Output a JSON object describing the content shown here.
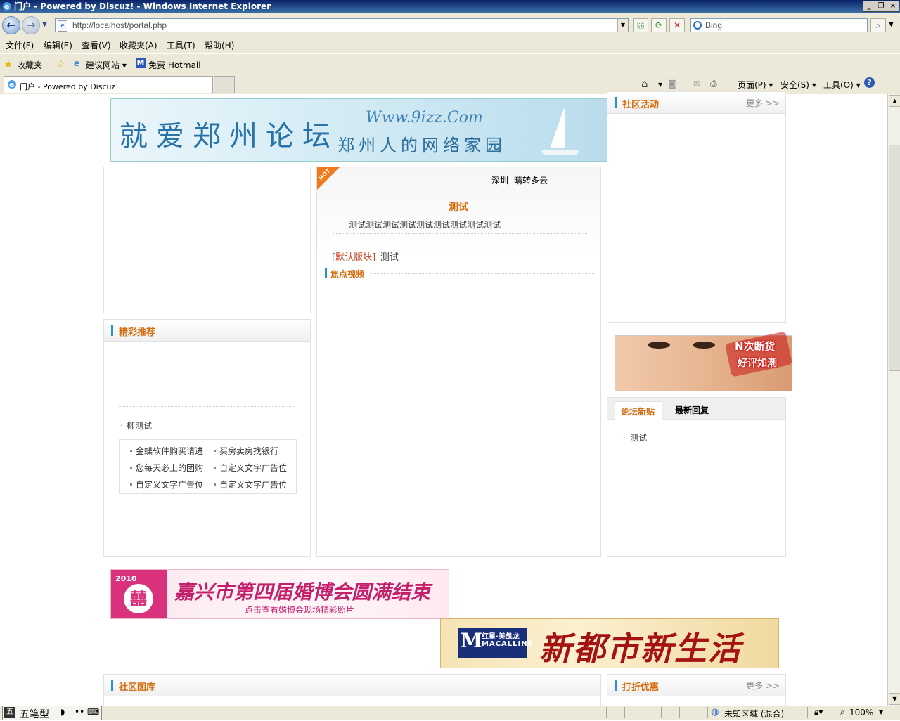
{
  "window": {
    "title": "门户 - Powered by Discuz! - Windows Internet Explorer"
  },
  "address": {
    "url": "http://localhost/portal.php"
  },
  "search": {
    "placeholder": "Bing"
  },
  "menu": [
    "文件(F)",
    "编辑(E)",
    "查看(V)",
    "收藏夹(A)",
    "工具(T)",
    "帮助(H)"
  ],
  "favorites": {
    "label": "收藏夹",
    "suggested": "建议网站 ▾",
    "hotmail": "免费 Hotmail"
  },
  "tab": {
    "label": "门户 - Powered by Discuz!"
  },
  "commandbar": {
    "page": "页面(P) ▾",
    "safety": "安全(S) ▾",
    "tools": "工具(O) ▾"
  },
  "banners": {
    "top": {
      "title": "就爱郑州论坛",
      "url": "Www.9izz.Com",
      "sub": "郑州人的网络家园"
    },
    "wedding": {
      "year": "2010",
      "title": "嘉兴市第四届婚博会圆满结束",
      "sub": "点击查看婚博会现场精彩照片",
      "logo_char": "囍"
    },
    "macalline": {
      "brand_cn": "红星·美凯龙",
      "brand_en": "MACALLINE",
      "slogan": "新都市新生活",
      "logo_char": "M"
    },
    "face": {
      "line1": "N次断货",
      "line2": "好评如潮"
    }
  },
  "center": {
    "hot": "HOT",
    "weather_city": "深圳",
    "weather_text": "晴转多云",
    "headline": "测试",
    "summary": "测试测试测试测试测试测试测试测试测试",
    "category": "[默认版块]",
    "post": "测试",
    "video_title": "焦点视频"
  },
  "left": {
    "recommend_title": "精彩推荐",
    "item": "柳测试",
    "text_ads": [
      "金蝶软件购买请进",
      "买房卖房找银行",
      "您每天必上的团购",
      "自定义文字广告位",
      "自定义文字广告位",
      "自定义文字广告位"
    ]
  },
  "right": {
    "activity_title": "社区活动",
    "more": "更多 >>",
    "tab_new": "论坛新贴",
    "tab_reply": "最新回复",
    "new_item": "测试"
  },
  "bottom": {
    "gallery_title": "社区图库",
    "discount_title": "打折优惠",
    "more": "更多 >>"
  },
  "status": {
    "ime": "五笔型",
    "zone": "未知区域 (混合)",
    "zoom": "100%"
  }
}
